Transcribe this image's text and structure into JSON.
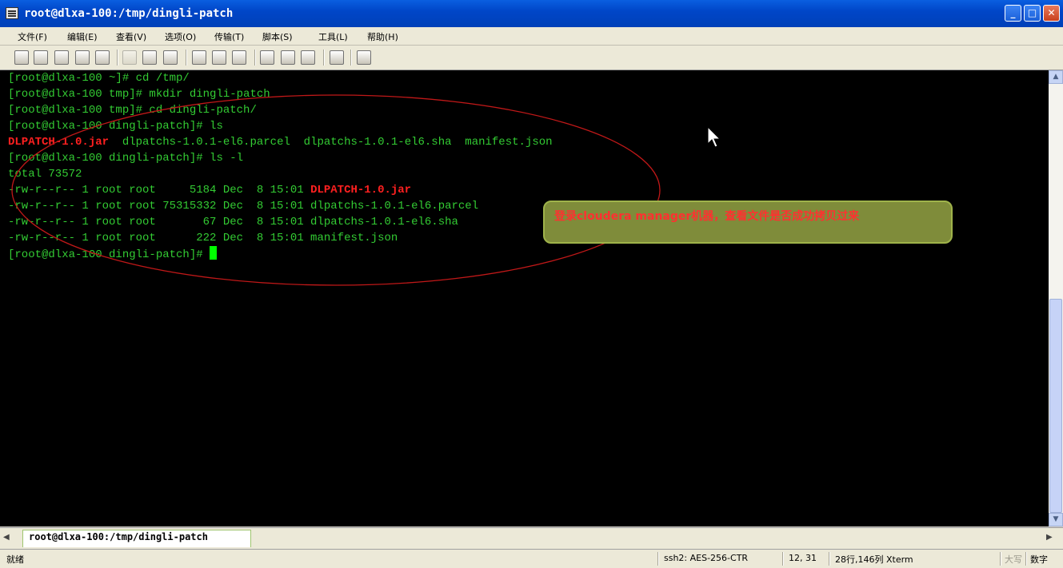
{
  "window": {
    "title": "root@dlxa-100:/tmp/dingli-patch",
    "min": "_",
    "max": "□",
    "close": "✕"
  },
  "menu": [
    "文件(F)",
    "编辑(E)",
    "查看(V)",
    "选项(O)",
    "传输(T)",
    "脚本(S)",
    "工具(L)",
    "帮助(H)"
  ],
  "terminal": {
    "l1": "[root@dlxa-100 ~]# cd /tmp/",
    "l2": "[root@dlxa-100 tmp]# mkdir dingli-patch",
    "l3": "[root@dlxa-100 tmp]# cd dingli-patch/",
    "l4": "[root@dlxa-100 dingli-patch]# ls",
    "l5a": "DLPATCH-1.0.jar",
    "l5b": "  dlpatchs-1.0.1-el6.parcel  dlpatchs-1.0.1-el6.sha  manifest.json",
    "l6": "[root@dlxa-100 dingli-patch]# ls -l",
    "l7": "total 73572",
    "l8a": "-rw-r--r-- 1 root root     5184 Dec  8 15:01 ",
    "l8b": "DLPATCH-1.0.jar",
    "l9": "-rw-r--r-- 1 root root 75315332 Dec  8 15:01 dlpatchs-1.0.1-el6.parcel",
    "l10": "-rw-r--r-- 1 root root       67 Dec  8 15:01 dlpatchs-1.0.1-el6.sha",
    "l11": "-rw-r--r-- 1 root root      222 Dec  8 15:01 manifest.json",
    "l12": "[root@dlxa-100 dingli-patch]# "
  },
  "annotation": "登录cloudera manager机器，查看文件是否成功拷贝过来",
  "tabs": {
    "left": "◀",
    "right": "▶",
    "active": "root@dlxa-100:/tmp/dingli-patch"
  },
  "scroll": {
    "up": "▲",
    "down": "▼"
  },
  "status": {
    "ready": "就绪",
    "cipher": "ssh2: AES-256-CTR",
    "pos": "12,   31",
    "size": "28行,146列 Xterm",
    "caps": "大写",
    "num": "数字"
  },
  "colors": {
    "terminal_text": "#33cc33",
    "highlight": "#ff2020",
    "annotation_bg": "#7f8c3a"
  }
}
